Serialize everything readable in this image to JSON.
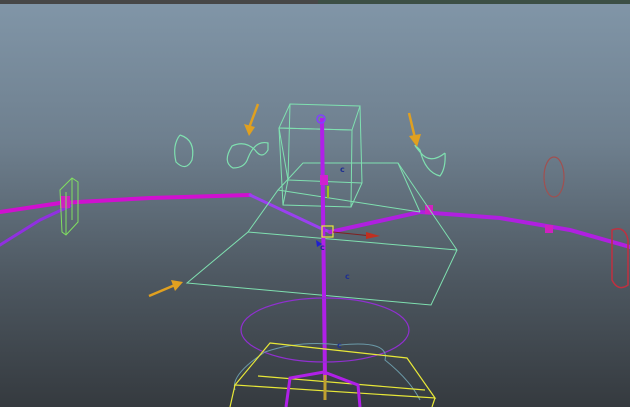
{
  "viewport": {
    "panel": "maya-perspective-viewport",
    "colors": {
      "background_top": "#8196a8",
      "background_bottom": "#353a3f",
      "wireframe_curve": "#7fe0b0",
      "joint": "#c020e0",
      "selected_control": "#e8e838",
      "arrow_annotation": "#e0a020",
      "inactive_curve": "#a05050",
      "move_x": "#c03020"
    },
    "pivot_labels": [
      "c",
      "c",
      "c",
      "c"
    ],
    "annotation_arrows": 3
  }
}
